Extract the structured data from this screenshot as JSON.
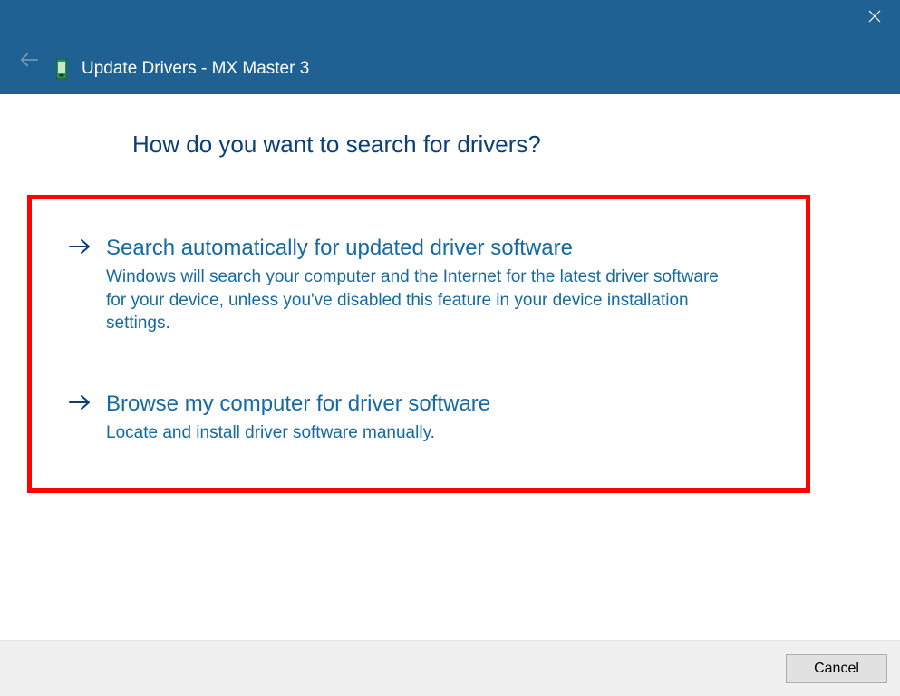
{
  "titlebar": {
    "title": "Update Drivers - MX Master 3"
  },
  "heading": "How do you want to search for drivers?",
  "options": [
    {
      "title": "Search automatically for updated driver software",
      "description": "Windows will search your computer and the Internet for the latest driver software for your device, unless you've disabled this feature in your device installation settings."
    },
    {
      "title": "Browse my computer for driver software",
      "description": "Locate and install driver software manually."
    }
  ],
  "footer": {
    "cancel_label": "Cancel"
  }
}
